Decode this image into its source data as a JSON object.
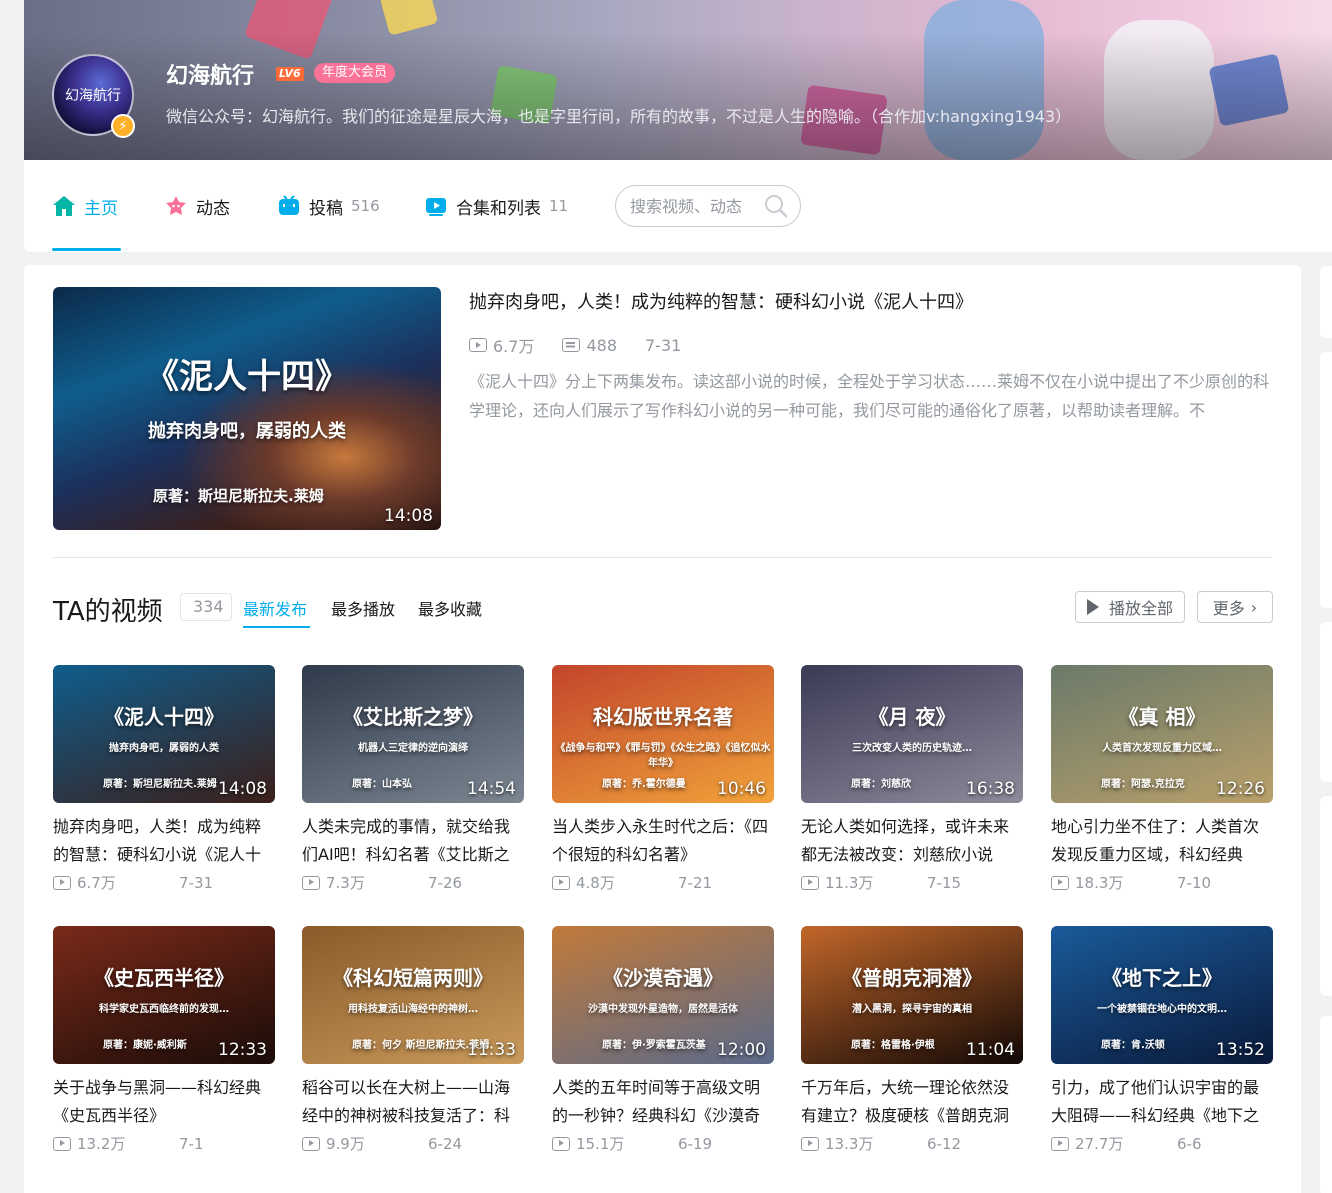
{
  "user": {
    "avatar_text": "幻海航行",
    "name": "幻海航行",
    "level": "LV6",
    "vip_label": "年度大会员",
    "sign": "微信公众号：幻海航行。我们的征途是星辰大海，也是字里行间，所有的故事，不过是人生的隐喻。（合作加v:hangxing1943）"
  },
  "nav": {
    "home": "主页",
    "dynamic": "动态",
    "upload": "投稿",
    "upload_count": "516",
    "collection": "合集和列表",
    "collection_count": "11",
    "search_placeholder": "搜索视频、动态"
  },
  "featured": {
    "thumb_title": "《泥人十四》",
    "thumb_sub": "抛弃肉身吧，孱弱的人类",
    "thumb_author": "原著：斯坦尼斯拉夫.莱姆",
    "duration": "14:08",
    "title": "抛弃肉身吧，人类！成为纯粹的智慧：硬科幻小说《泥人十四》",
    "views": "6.7万",
    "danmaku": "488",
    "date": "7-31",
    "desc": "《泥人十四》分上下两集发布。读这部小说的时候，全程处于学习状态……莱姆不仅在小说中提出了不少原创的科学理论，还向人们展示了写作科幻小说的另一种可能，我们尽可能的通俗化了原著，以帮助读者理解。不"
  },
  "section": {
    "title": "TA的视频",
    "count": "334",
    "tabs": [
      "最新发布",
      "最多播放",
      "最多收藏"
    ],
    "play_all": "播放全部",
    "more": "更多"
  },
  "videos": [
    {
      "t1": "《泥人十四》",
      "t2": "抛弃肉身吧，孱弱的人类",
      "t3": "原著：斯坦尼斯拉夫.莱姆",
      "dur": "14:08",
      "title": "抛弃肉身吧，人类！成为纯粹的智慧：硬科幻小说《泥人十四》",
      "views": "6.7万",
      "date": "7-31",
      "c1": "#0f5d8c",
      "c2": "#3c1f1a"
    },
    {
      "t1": "《艾比斯之梦》",
      "t2": "机器人三定律的逆向演绎",
      "t3": "原著：山本弘",
      "dur": "14:54",
      "title": "人类未完成的事情，就交给我们AI吧！科幻名著《艾比斯之梦》",
      "views": "7.3万",
      "date": "7-26",
      "c1": "#2f3a4a",
      "c2": "#7d8793"
    },
    {
      "t1": "科幻版世界名著",
      "t2": "《战争与和平》《罪与罚》《众生之路》《追忆似水年华》",
      "t3": "原著：乔.霍尔德曼",
      "dur": "10:46",
      "title": "当人类步入永生时代之后：《四个很短的科幻名著》",
      "views": "4.8万",
      "date": "7-21",
      "c1": "#c2452b",
      "c2": "#f1a23a"
    },
    {
      "t1": "《月 夜》",
      "t2": "三次改变人类的历史轨迹…",
      "t3": "原著：刘慈欣",
      "dur": "16:38",
      "title": "无论人类如何选择，或许未来都无法被改变：刘慈欣小说《月夜》",
      "views": "11.3万",
      "date": "7-15",
      "c1": "#3b3a55",
      "c2": "#8d8a9a"
    },
    {
      "t1": "《真 相》",
      "t2": "人类首次发现反重力区域…",
      "t3": "原著：阿瑟.克拉克",
      "dur": "12:26",
      "title": "地心引力坐不住了：人类首次发现反重力区域，科幻经典《真相》",
      "views": "18.3万",
      "date": "7-10",
      "c1": "#6b7a6a",
      "c2": "#b9a06a"
    },
    {
      "t1": "《史瓦西半径》",
      "t2": "科学家史瓦西临终前的发现…",
      "t3": "原著：康妮·威利斯",
      "dur": "12:33",
      "title": "关于战争与黑洞——科幻经典《史瓦西半径》",
      "views": "13.2万",
      "date": "7-1",
      "c1": "#7a2a1a",
      "c2": "#1a0c08"
    },
    {
      "t1": "《科幻短篇两则》",
      "t2": "用科技复活山海经中的神树…",
      "t3": "原著：何夕 斯坦尼斯拉夫.莱姆",
      "dur": "11:33",
      "title": "稻谷可以长在大树上——山海经中的神树被科技复活了：科幻短篇两则",
      "views": "9.9万",
      "date": "6-24",
      "c1": "#8a5a2a",
      "c2": "#c99a5a"
    },
    {
      "t1": "《沙漠奇遇》",
      "t2": "沙漠中发现外星造物，居然是活体",
      "t3": "原著：伊·罗索霍瓦茨基",
      "dur": "12:00",
      "title": "人类的五年时间等于高级文明的一秒钟？经典科幻《沙漠奇遇》",
      "views": "15.1万",
      "date": "6-19",
      "c1": "#c27a3a",
      "c2": "#5a6a8a"
    },
    {
      "t1": "《普朗克洞潜》",
      "t2": "潜入黑洞，探寻宇宙的真相",
      "t3": "原著：格雷格·伊根",
      "dur": "11:04",
      "title": "千万年后，大统一理论依然没有建立？极度硬核《普朗克洞潜》",
      "views": "13.3万",
      "date": "6-12",
      "c1": "#c2672a",
      "c2": "#120806"
    },
    {
      "t1": "《地下之上》",
      "t2": "一个被禁锢在地心中的文明…",
      "t3": "原著：肯.沃顿",
      "dur": "13:52",
      "title": "引力，成了他们认识宇宙的最大阻碍——科幻经典《地下之上》",
      "views": "27.7万",
      "date": "6-6",
      "c1": "#1a5a9a",
      "c2": "#0a1a3a"
    }
  ]
}
